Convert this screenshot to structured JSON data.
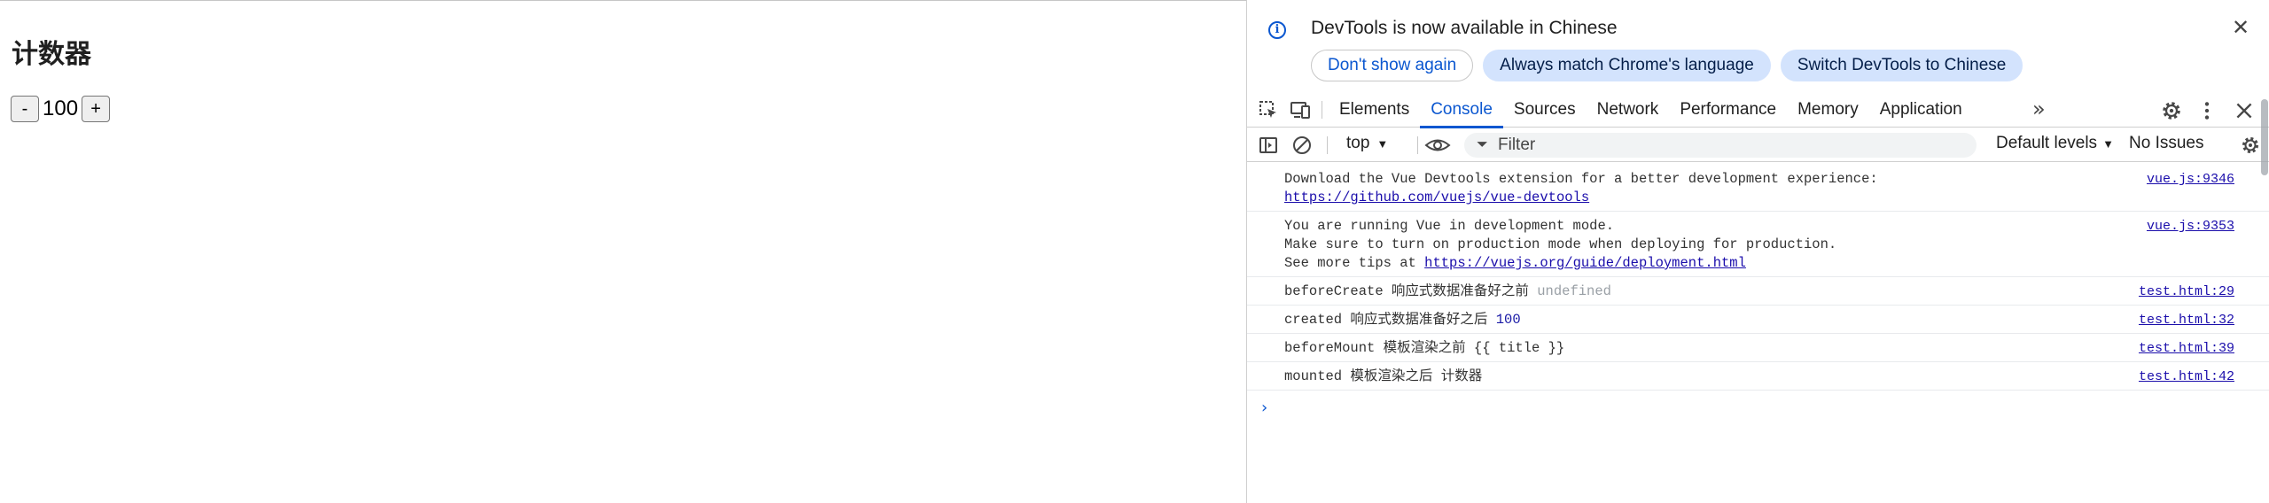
{
  "page": {
    "title": "计数器",
    "decrement_label": "-",
    "increment_label": "+",
    "count": "100"
  },
  "devtools": {
    "infobar": {
      "title": "DevTools is now available in Chinese",
      "buttons": [
        "Don't show again",
        "Always match Chrome's language",
        "Switch DevTools to Chinese"
      ]
    },
    "tabs": [
      "Elements",
      "Console",
      "Sources",
      "Network",
      "Performance",
      "Memory",
      "Application"
    ],
    "active_tab": "Console",
    "toolbar": {
      "context": "top",
      "filter_placeholder": "Filter",
      "levels": "Default levels",
      "issues": "No Issues"
    },
    "messages": [
      {
        "line1": "Download the Vue Devtools extension for a better development experience:",
        "link": "https://github.com/vuejs/vue-devtools",
        "source": "vue.js:9346"
      },
      {
        "line1": "You are running Vue in development mode.",
        "line2": "Make sure to turn on production mode when deploying for production.",
        "line3_prefix": "See more tips at ",
        "link": "https://vuejs.org/guide/deployment.html",
        "source": "vue.js:9353"
      },
      {
        "text": "beforeCreate 响应式数据准备好之前",
        "value": "undefined",
        "source": "test.html:29"
      },
      {
        "text": "created 响应式数据准备好之后",
        "value": "100",
        "source": "test.html:32"
      },
      {
        "text": "beforeMount 模板渲染之前 {{ title }}",
        "source": "test.html:39"
      },
      {
        "text": "mounted 模板渲染之后 计数器",
        "source": "test.html:42"
      }
    ]
  },
  "colors": {
    "accent": "#0b57d0",
    "link": "#1a0dab",
    "pill_bg": "#d3e3fd"
  },
  "icons": [
    "info-icon",
    "close-icon",
    "inspect-element-icon",
    "device-toolbar-icon",
    "more-tabs-icon",
    "settings-icon",
    "kebab-menu-icon",
    "sidebar-toggle-icon",
    "clear-console-icon",
    "eye-icon",
    "filter-icon",
    "chevron-down-icon",
    "console-prompt-icon"
  ]
}
